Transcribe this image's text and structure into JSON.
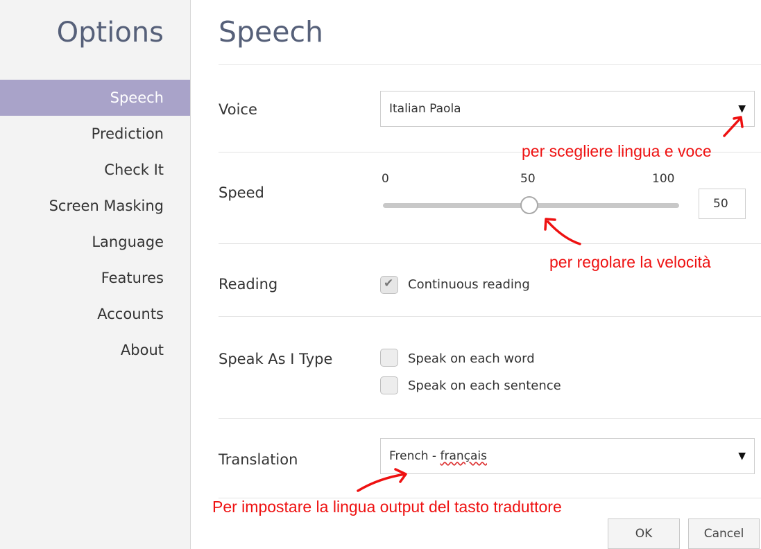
{
  "sidebar": {
    "title": "Options",
    "items": [
      {
        "label": "Speech",
        "active": true
      },
      {
        "label": "Prediction"
      },
      {
        "label": "Check It"
      },
      {
        "label": "Screen Masking"
      },
      {
        "label": "Language"
      },
      {
        "label": "Features"
      },
      {
        "label": "Accounts"
      },
      {
        "label": "About"
      }
    ]
  },
  "main": {
    "title": "Speech",
    "voice": {
      "label": "Voice",
      "value": "Italian Paola"
    },
    "speed": {
      "label": "Speed",
      "min_label": "0",
      "mid_label": "50",
      "max_label": "100",
      "value": "50",
      "level": 0.5
    },
    "reading": {
      "label": "Reading",
      "option": "Continuous reading",
      "checked": true
    },
    "speak_as_i_type": {
      "label": "Speak As I Type",
      "options": [
        {
          "label": "Speak on each word",
          "checked": false
        },
        {
          "label": "Speak on each sentence",
          "checked": false
        }
      ]
    },
    "translation": {
      "label": "Translation",
      "value_prefix": "French - ",
      "value_native": "français"
    },
    "buttons": {
      "ok": "OK",
      "cancel": "Cancel"
    }
  },
  "annotations": {
    "voice_note": "per scegliere lingua e voce",
    "speed_note": "per regolare la velocità",
    "translation_note": "Per impostare la lingua output del tasto traduttore"
  },
  "colors": {
    "accent": "#a9a3c9",
    "title": "#566079",
    "annotation": "#ee1111"
  }
}
